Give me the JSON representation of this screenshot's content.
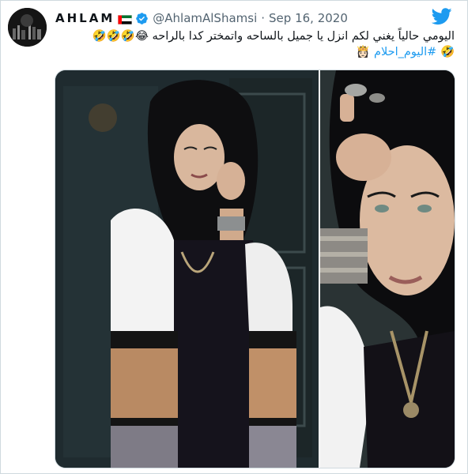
{
  "tweet": {
    "display_name": "AHLAM",
    "handle": "@AhlamAlShamsi",
    "separator": "·",
    "date": "Sep 16, 2020",
    "text_line1": "اليومي حالياً يغني لكم انزل يا جميل بالساحه واتمختر كدا بالراحه 😂🤣🤣🤣",
    "text_line2_emoji": "🤣",
    "hashtag": "#اليوم_احلام",
    "trailing_emoji": "👸🏻"
  },
  "icons": {
    "flag": "uae-flag-icon",
    "verified": "verified-badge-icon",
    "logo": "twitter-bird-icon"
  },
  "colors": {
    "accent": "#1d9bf0",
    "text": "#0f1419",
    "muted": "#536471",
    "border": "#cfd9de"
  }
}
